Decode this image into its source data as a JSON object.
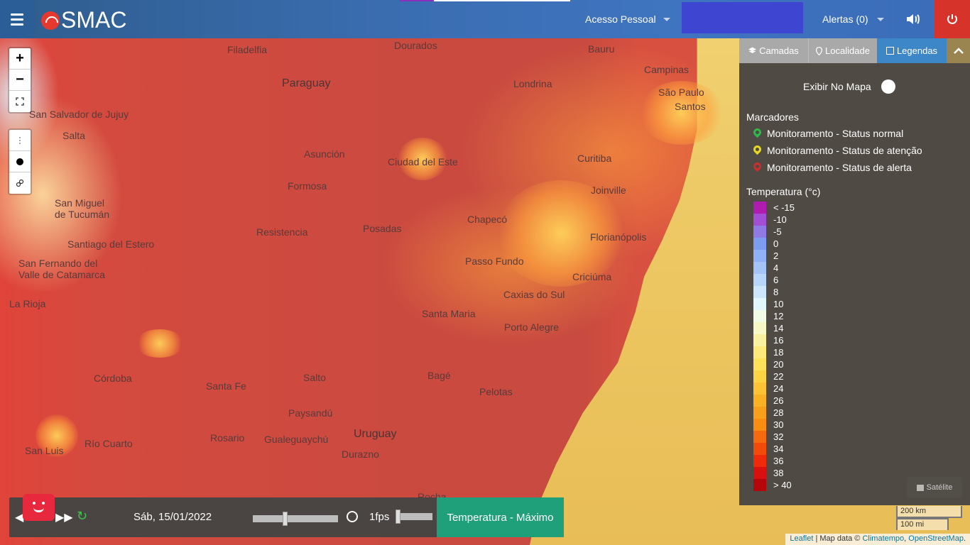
{
  "header": {
    "app_name": "SMAC",
    "acesso_label": "Acesso Pessoal",
    "alertas_label": "Alertas (0)"
  },
  "map": {
    "places": [
      {
        "name": "Filadelfia",
        "big": false
      },
      {
        "name": "Dourados",
        "big": false
      },
      {
        "name": "Bauru",
        "big": false
      },
      {
        "name": "Campinas",
        "big": false
      },
      {
        "name": "Paraguay",
        "big": true
      },
      {
        "name": "Londrina",
        "big": false
      },
      {
        "name": "São Paulo",
        "big": false
      },
      {
        "name": "Santos",
        "big": false
      },
      {
        "name": "San Salvador de Jujuy",
        "big": false
      },
      {
        "name": "Salta",
        "big": false
      },
      {
        "name": "Asunción",
        "big": false
      },
      {
        "name": "Ciudad del Este",
        "big": false
      },
      {
        "name": "Curitiba",
        "big": false
      },
      {
        "name": "Formosa",
        "big": false
      },
      {
        "name": "Joinville",
        "big": false
      },
      {
        "name": "San Miguel de Tucumán",
        "big": false
      },
      {
        "name": "Chapecó",
        "big": false
      },
      {
        "name": "Resistencia",
        "big": false
      },
      {
        "name": "Posadas",
        "big": false
      },
      {
        "name": "Florianópolis",
        "big": false
      },
      {
        "name": "Santiago del Estero",
        "big": false
      },
      {
        "name": "San Fernando del Valle de Catamarca",
        "big": false
      },
      {
        "name": "Passo Fundo",
        "big": false
      },
      {
        "name": "Criciúma",
        "big": false
      },
      {
        "name": "Caxias do Sul",
        "big": false
      },
      {
        "name": "La Rioja",
        "big": false
      },
      {
        "name": "Santa Maria",
        "big": false
      },
      {
        "name": "Porto Alegre",
        "big": false
      },
      {
        "name": "Córdoba",
        "big": false
      },
      {
        "name": "Salto",
        "big": false
      },
      {
        "name": "Bagé",
        "big": false
      },
      {
        "name": "Santa Fe",
        "big": false
      },
      {
        "name": "Pelotas",
        "big": false
      },
      {
        "name": "Paysandú",
        "big": false
      },
      {
        "name": "Uruguay",
        "big": true
      },
      {
        "name": "San Luis",
        "big": false
      },
      {
        "name": "Río Cuarto",
        "big": false
      },
      {
        "name": "Rosario",
        "big": false
      },
      {
        "name": "Gualeguaychú",
        "big": false
      },
      {
        "name": "Durazno",
        "big": false
      },
      {
        "name": "Rocha",
        "big": false
      }
    ],
    "controls": {
      "zoom_in": "+",
      "zoom_out": "−"
    }
  },
  "panel": {
    "tabs": [
      {
        "label": "Camadas",
        "icon": "layers-icon"
      },
      {
        "label": "Localidade",
        "icon": "map-pin-icon"
      },
      {
        "label": "Legendas",
        "icon": "square-icon"
      }
    ],
    "exibir_label": "Exibir No Mapa",
    "marcadores_title": "Marcadores",
    "markers": [
      {
        "label": "Monitoramento - Status normal",
        "color": "#2fb84a"
      },
      {
        "label": "Monitoramento - Status de atenção",
        "color": "#e5d81f"
      },
      {
        "label": "Monitoramento - Status de alerta",
        "color": "#cc2d2d"
      }
    ],
    "temp_title": "Temperatura (°c)",
    "scale": [
      {
        "label": "< -15",
        "color": "#b01cb0"
      },
      {
        "label": "-10",
        "color": "#a24fd6"
      },
      {
        "label": "-5",
        "color": "#8f7ae6"
      },
      {
        "label": "0",
        "color": "#7c9cf0"
      },
      {
        "label": "2",
        "color": "#8fb1f5"
      },
      {
        "label": "4",
        "color": "#a4c4f8"
      },
      {
        "label": "6",
        "color": "#b8d6fa"
      },
      {
        "label": "8",
        "color": "#cde6fc"
      },
      {
        "label": "10",
        "color": "#e2f6fd"
      },
      {
        "label": "12",
        "color": "#f2fbe6"
      },
      {
        "label": "14",
        "color": "#f8f7c6"
      },
      {
        "label": "16",
        "color": "#faf1a0"
      },
      {
        "label": "18",
        "color": "#fbe97c"
      },
      {
        "label": "20",
        "color": "#fde25a"
      },
      {
        "label": "22",
        "color": "#fcd443"
      },
      {
        "label": "24",
        "color": "#fbc434"
      },
      {
        "label": "26",
        "color": "#fab225"
      },
      {
        "label": "28",
        "color": "#f9a01a"
      },
      {
        "label": "30",
        "color": "#f88d12"
      },
      {
        "label": "32",
        "color": "#f56a0d"
      },
      {
        "label": "34",
        "color": "#f24a0a"
      },
      {
        "label": "36",
        "color": "#ee2a0a"
      },
      {
        "label": "38",
        "color": "#d81010"
      },
      {
        "label": "> 40",
        "color": "#b5060c"
      }
    ]
  },
  "satellite_label": "Satélite",
  "scalebar": {
    "km": "200 km",
    "mi": "100 mi"
  },
  "attribution": {
    "leaflet": "Leaflet",
    "separator": " | Map data © ",
    "climatempo": "Climatempo",
    "comma": ", ",
    "osm": "OpenStreetMap",
    "dot": "."
  },
  "player": {
    "date": "Sáb, 15/01/2022",
    "fps": "1fps",
    "layer": "Temperatura - Máximo",
    "time_position_pct": 37,
    "fps_position_pct": 0
  }
}
